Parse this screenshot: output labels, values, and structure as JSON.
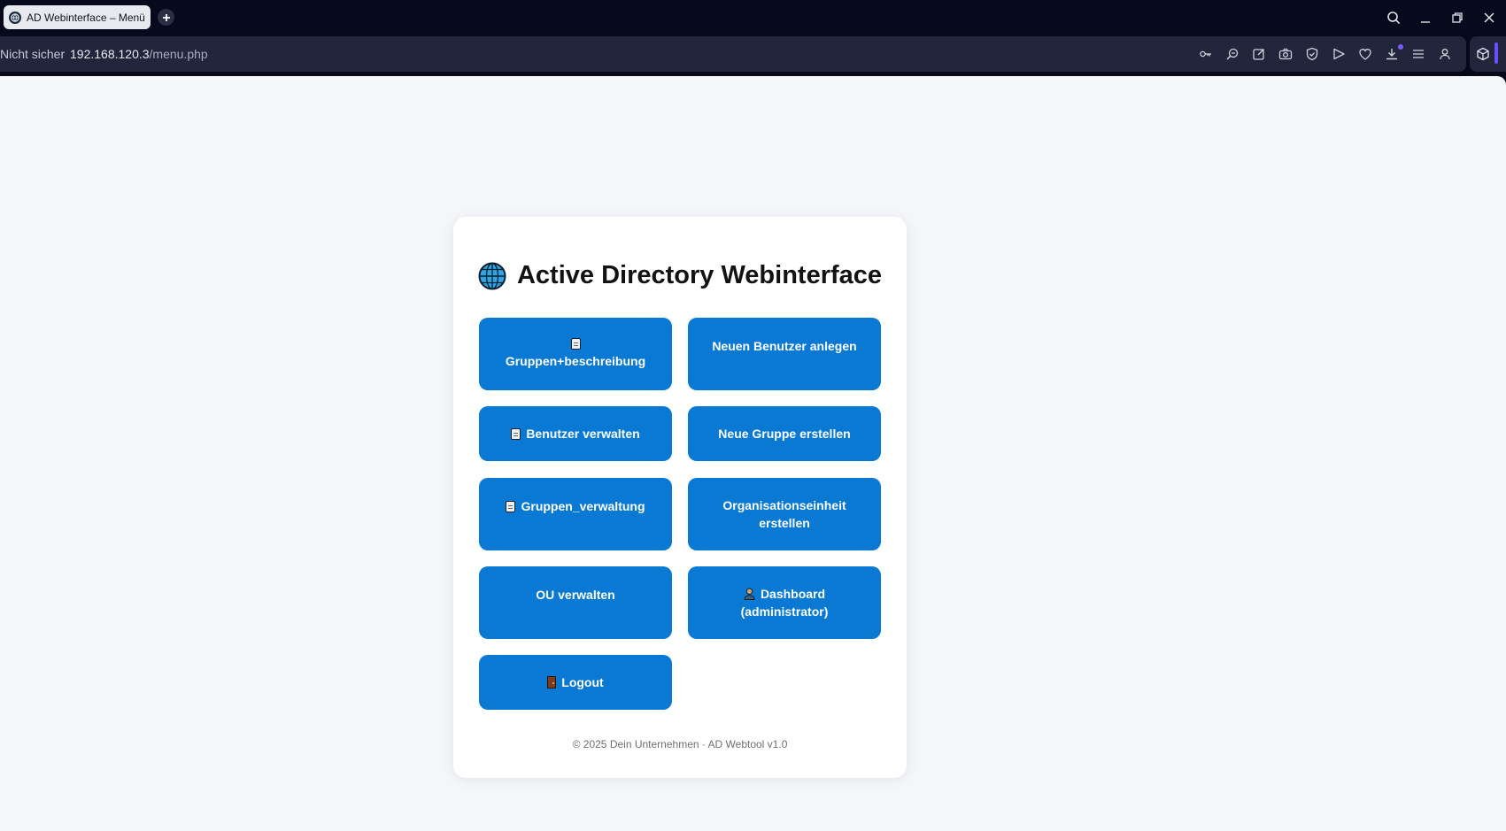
{
  "browser": {
    "tab_title": "AD Webinterface – Menü",
    "security_label": "Nicht sicher",
    "url_host": "192.168.120.3",
    "url_path": "/menu.php",
    "toolbar_icons": [
      "key-icon",
      "zoom-icon",
      "edit-icon",
      "camera-icon",
      "shield-icon",
      "send-icon",
      "heart-icon",
      "download-icon",
      "menu-icon",
      "profile-icon",
      "cube-icon"
    ]
  },
  "page": {
    "title": "Active Directory Webinterface",
    "buttons": {
      "gruppen_beschreibung": "Gruppen+beschreibung",
      "neuer_benutzer": "Neuen Benutzer anlegen",
      "benutzer_verwalten": "Benutzer verwalten",
      "neue_gruppe": "Neue Gruppe erstellen",
      "gruppen_verwaltung": "Gruppen_verwaltung",
      "ou_erstellen": "Organisationseinheit erstellen",
      "ou_verwalten": "OU verwalten",
      "dashboard_line1": "Dashboard",
      "dashboard_line2": "(administrator)",
      "logout": "Logout"
    },
    "footer": "© 2025 Dein Unternehmen · AD Webtool v1.0"
  },
  "colors": {
    "button_bg": "#0a79d3",
    "page_bg": "#f4f6f9",
    "card_bg": "#ffffff",
    "chrome_bg": "#060a1c",
    "addressbar_bg": "#22263d"
  }
}
